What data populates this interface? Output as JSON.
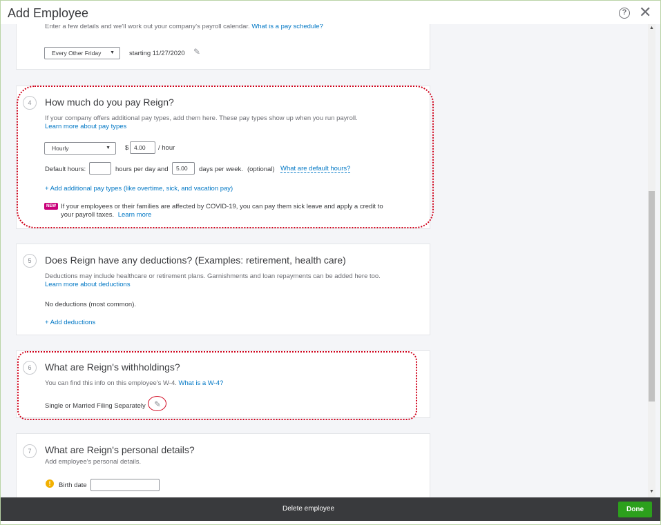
{
  "window": {
    "title": "Add Employee"
  },
  "section_pay_schedule": {
    "description": "Enter a few details and we'll work out your company's payroll calendar.",
    "help_link": "What is a pay schedule?",
    "schedule_select": "Every Other Friday",
    "starting_text": "starting 11/27/2020"
  },
  "section_pay": {
    "number": "4",
    "title": "How much do you pay Reign?",
    "description": "If your company offers additional pay types, add them here. These pay types show up when you run payroll.",
    "learn_more": "Learn more about pay types",
    "pay_type_select": "Hourly",
    "currency": "$",
    "rate": "4.00",
    "rate_unit": "/ hour",
    "default_hours_label": "Default hours:",
    "hours_per_day_value": "",
    "hours_per_day_label": "hours per day and",
    "days_per_week_value": "5.00",
    "days_per_week_label": "days per week.",
    "optional": "(optional)",
    "default_hours_link": "What are default hours?",
    "add_pay_types": "+ Add additional pay types (like overtime, sick, and vacation pay)",
    "new_badge": "NEW",
    "covid_line1": "If your employees or their families are affected by COVID-19, you can pay them sick leave and apply a credit to",
    "covid_line2": "your payroll taxes.",
    "covid_learn_more": "Learn more"
  },
  "section_deductions": {
    "number": "5",
    "title": "Does Reign have any deductions? (Examples: retirement, health care)",
    "description": "Deductions may include healthcare or retirement plans. Garnishments and loan repayments can be added here too.",
    "learn_more": "Learn more about deductions",
    "status": "No deductions (most common).",
    "add_link": "+ Add deductions"
  },
  "section_withholdings": {
    "number": "6",
    "title": "What are Reign's withholdings?",
    "description": "You can find this info on this employee's W-4.",
    "help_link": "What is a W-4?",
    "filing_status": "Single or Married Filing Separately"
  },
  "section_personal": {
    "number": "7",
    "title": "What are Reign's personal details?",
    "description": "Add employee's personal details.",
    "birth_date_label": "Birth date",
    "birth_date_value": ""
  },
  "footer": {
    "delete_label": "Delete employee",
    "done_label": "Done"
  },
  "colors": {
    "accent_green": "#2ca01c",
    "link_blue": "#0077c5",
    "annotation_red": "#d0021b",
    "footer_bg": "#393a3d"
  }
}
